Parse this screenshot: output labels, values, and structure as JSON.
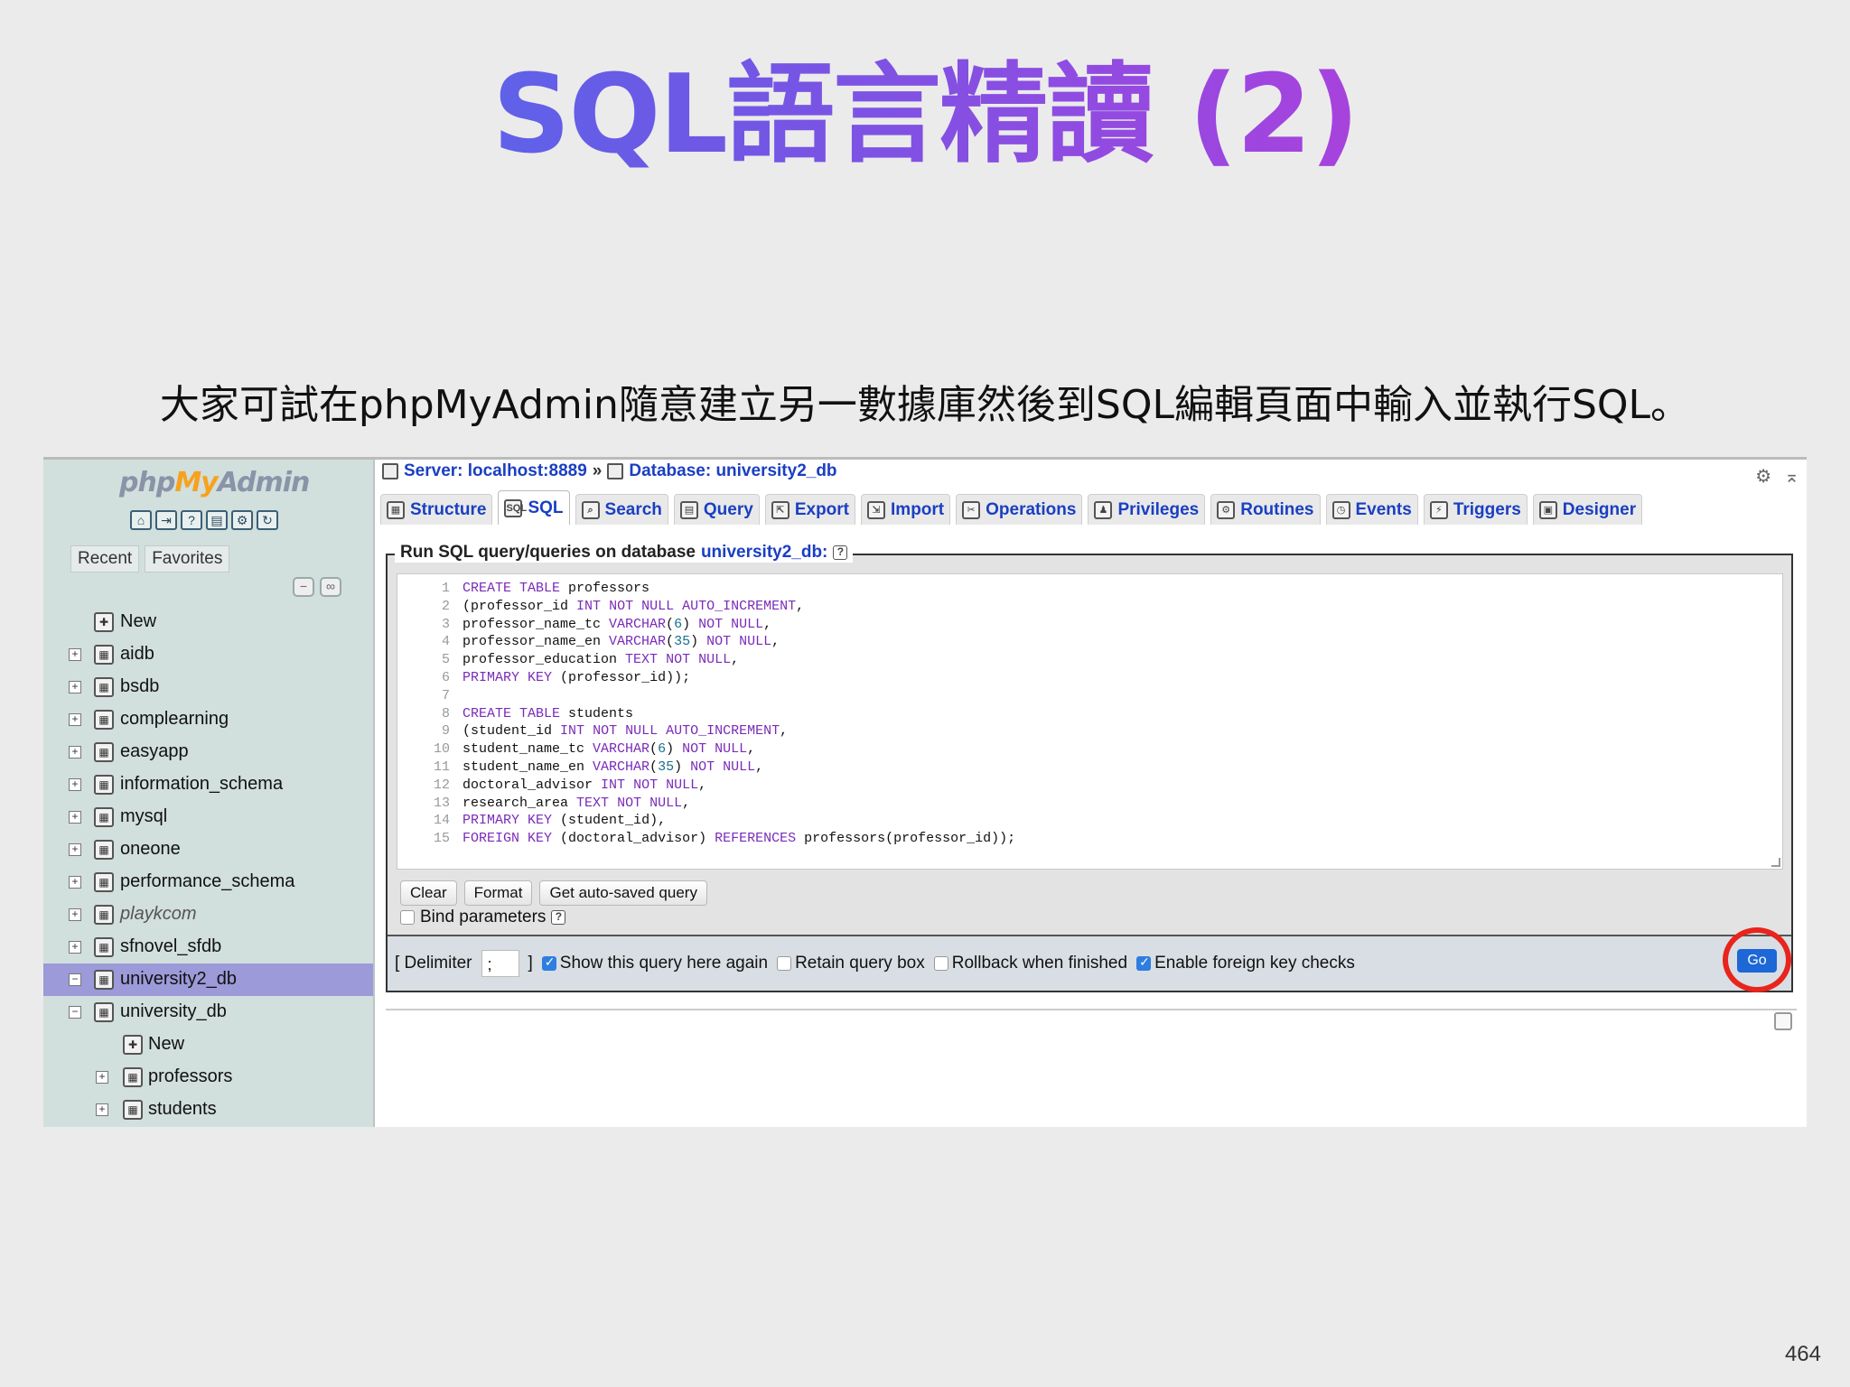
{
  "slide": {
    "title": "SQL語言精讀 (2)",
    "subtitle": "大家可試在phpMyAdmin隨意建立另一數據庫然後到SQL編輯頁面中輸入並執行SQL。",
    "page_number": "464"
  },
  "sidebar": {
    "logo": {
      "php": "php",
      "my": "My",
      "admin": "Admin"
    },
    "tabs": [
      "Recent",
      "Favorites"
    ],
    "tree": [
      {
        "label": "New",
        "level": 0,
        "expander": ""
      },
      {
        "label": "aidb",
        "level": 0,
        "expander": "+"
      },
      {
        "label": "bsdb",
        "level": 0,
        "expander": "+"
      },
      {
        "label": "complearning",
        "level": 0,
        "expander": "+"
      },
      {
        "label": "easyapp",
        "level": 0,
        "expander": "+"
      },
      {
        "label": "information_schema",
        "level": 0,
        "expander": "+"
      },
      {
        "label": "mysql",
        "level": 0,
        "expander": "+"
      },
      {
        "label": "oneone",
        "level": 0,
        "expander": "+"
      },
      {
        "label": "performance_schema",
        "level": 0,
        "expander": "+"
      },
      {
        "label": "playkcom",
        "level": 0,
        "expander": "+"
      },
      {
        "label": "sfnovel_sfdb",
        "level": 0,
        "expander": "+"
      },
      {
        "label": "university2_db",
        "level": 0,
        "expander": "−"
      },
      {
        "label": "university_db",
        "level": 0,
        "expander": "−"
      },
      {
        "label": "New",
        "level": 1,
        "expander": ""
      },
      {
        "label": "professors",
        "level": 1,
        "expander": "+"
      },
      {
        "label": "students",
        "level": 1,
        "expander": "+"
      }
    ]
  },
  "breadcrumb": {
    "server": "Server: localhost:8889",
    "separator": "»",
    "database": "Database: university2_db"
  },
  "tabs": [
    {
      "label": "Structure",
      "icon": "structure-icon",
      "glyph": "▦"
    },
    {
      "label": "SQL",
      "icon": "sql-icon",
      "glyph": "SQL"
    },
    {
      "label": "Search",
      "icon": "search-icon",
      "glyph": "⌕"
    },
    {
      "label": "Query",
      "icon": "query-icon",
      "glyph": "▤"
    },
    {
      "label": "Export",
      "icon": "export-icon",
      "glyph": "⇱"
    },
    {
      "label": "Import",
      "icon": "import-icon",
      "glyph": "⇲"
    },
    {
      "label": "Operations",
      "icon": "operations-icon",
      "glyph": "✂"
    },
    {
      "label": "Privileges",
      "icon": "privileges-icon",
      "glyph": "♟"
    },
    {
      "label": "Routines",
      "icon": "routines-icon",
      "glyph": "⚙"
    },
    {
      "label": "Events",
      "icon": "events-icon",
      "glyph": "◷"
    },
    {
      "label": "Triggers",
      "icon": "triggers-icon",
      "glyph": "⚡"
    },
    {
      "label": "Designer",
      "icon": "designer-icon",
      "glyph": "▣"
    }
  ],
  "panel": {
    "legend": "Run SQL query/queries on database",
    "database": "university2_db:"
  },
  "editor": {
    "lines": [
      "CREATE TABLE professors",
      "(professor_id INT NOT NULL AUTO_INCREMENT,",
      "professor_name_tc VARCHAR(6) NOT NULL,",
      "professor_name_en VARCHAR(35) NOT NULL,",
      "professor_education TEXT NOT NULL,",
      "PRIMARY KEY (professor_id));",
      "",
      "CREATE TABLE students",
      "(student_id INT NOT NULL AUTO_INCREMENT,",
      "student_name_tc VARCHAR(6) NOT NULL,",
      "student_name_en VARCHAR(35) NOT NULL,",
      "doctoral_advisor INT NOT NULL,",
      "research_area TEXT NOT NULL,",
      "PRIMARY KEY (student_id),",
      "FOREIGN KEY (doctoral_advisor) REFERENCES professors(professor_id));"
    ]
  },
  "buttons": {
    "clear": "Clear",
    "format": "Format",
    "get_autosaved": "Get auto-saved query"
  },
  "bind_parameters": {
    "label": "Bind parameters",
    "checked": false
  },
  "options": {
    "delimiter_label_open": "[ Delimiter",
    "delimiter_value": ";",
    "delimiter_label_close": "]",
    "show_query": {
      "label": "Show this query here again",
      "checked": true
    },
    "retain_box": {
      "label": "Retain query box",
      "checked": false
    },
    "rollback": {
      "label": "Rollback when finished",
      "checked": false
    },
    "foreign_keys": {
      "label": "Enable foreign key checks",
      "checked": true
    },
    "go": "Go"
  },
  "colors": {
    "accent_link": "#1a3fc2",
    "sidebar_bg": "#d1dfdd",
    "selected_db": "#9c9ad8",
    "go_button": "#1d67d6",
    "highlight_circle": "#e8241c"
  }
}
